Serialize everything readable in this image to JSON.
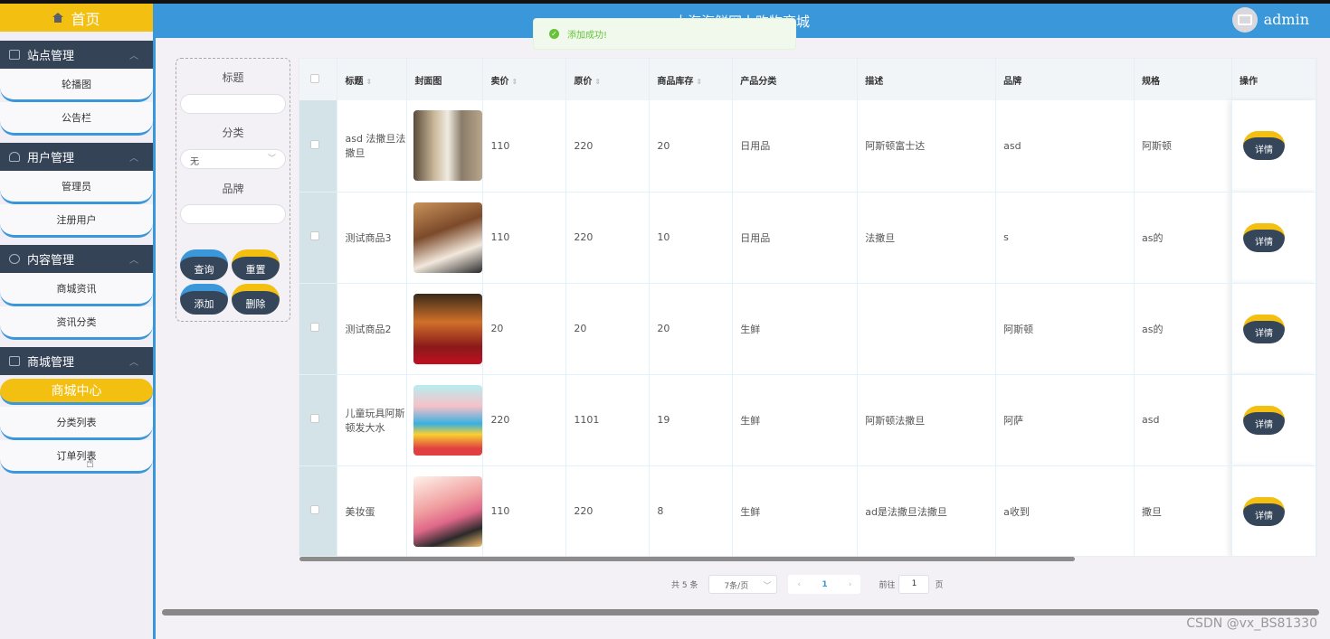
{
  "header": {
    "title": "大海海鲜网上购物商城",
    "username": "admin"
  },
  "toast": {
    "message": "添加成功!"
  },
  "sidebar": {
    "home": "首页",
    "groups": [
      {
        "title": "站点管理",
        "items": [
          "轮播图",
          "公告栏"
        ]
      },
      {
        "title": "用户管理",
        "items": [
          "管理员",
          "注册用户"
        ]
      },
      {
        "title": "内容管理",
        "items": [
          "商城资讯",
          "资讯分类"
        ]
      },
      {
        "title": "商城管理",
        "items": [
          "商城中心",
          "分类列表",
          "订单列表"
        ]
      }
    ]
  },
  "filter": {
    "title_label": "标题",
    "category_label": "分类",
    "category_value": "无",
    "brand_label": "品牌",
    "buttons": {
      "query": "查询",
      "reset": "重置",
      "add": "添加",
      "delete": "删除"
    }
  },
  "table": {
    "columns": [
      "标题",
      "封面图",
      "卖价",
      "原价",
      "商品库存",
      "产品分类",
      "描述",
      "品牌",
      "规格",
      "操作"
    ],
    "detail_label": "详情",
    "rows": [
      {
        "title": "asd 法撒旦法撒旦",
        "price": "110",
        "original": "220",
        "stock": "20",
        "category": "日用品",
        "desc": "阿斯顿富士达",
        "brand": "asd",
        "spec": "阿斯顿"
      },
      {
        "title": "测试商品3",
        "price": "110",
        "original": "220",
        "stock": "10",
        "category": "日用品",
        "desc": "法撒旦",
        "brand": "s",
        "spec": "as的"
      },
      {
        "title": "测试商品2",
        "price": "20",
        "original": "20",
        "stock": "20",
        "category": "生鲜",
        "desc": "",
        "brand": "阿斯顿",
        "spec": "as的"
      },
      {
        "title": "儿童玩具阿斯顿发大水",
        "price": "220",
        "original": "1101",
        "stock": "19",
        "category": "生鲜",
        "desc": "阿斯顿法撒旦",
        "brand": "阿萨",
        "spec": "asd"
      },
      {
        "title": "美妆蛋",
        "price": "110",
        "original": "220",
        "stock": "8",
        "category": "生鲜",
        "desc": "ad是法撒旦法撒旦",
        "brand": "a收到",
        "spec": "撒旦"
      }
    ]
  },
  "pagination": {
    "total": "共 5 条",
    "page_size": "7条/页",
    "current": "1",
    "goto_prefix": "前往",
    "goto_value": "1",
    "goto_suffix": "页"
  },
  "watermark": "CSDN @vx_BS81330",
  "colors": {
    "accent_blue": "#3a97da",
    "accent_yellow": "#f3c011",
    "dark": "#36465a"
  }
}
